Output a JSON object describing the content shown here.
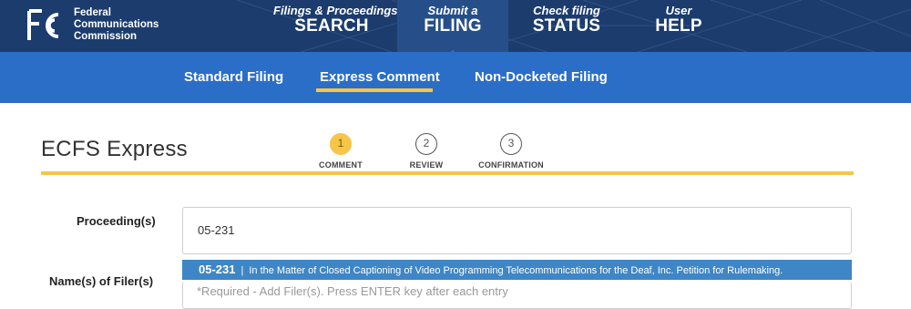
{
  "brand": {
    "logo_mark": "FCC",
    "name_lines": [
      "Federal",
      "Communications",
      "Commission"
    ]
  },
  "topnav": {
    "items": [
      {
        "sub": "Filings & Proceedings",
        "main": "SEARCH"
      },
      {
        "sub": "Submit a",
        "main": "FILING",
        "active": true
      },
      {
        "sub": "Check filing",
        "main": "STATUS"
      },
      {
        "sub": "User",
        "main": "HELP"
      }
    ]
  },
  "subnav": {
    "items": [
      "Standard Filing",
      "Express Comment",
      "Non-Docketed Filing"
    ],
    "active_index": 1
  },
  "page": {
    "title": "ECFS Express",
    "steps": [
      {
        "number": "1",
        "label": "COMMENT",
        "active": true
      },
      {
        "number": "2",
        "label": "REVIEW"
      },
      {
        "number": "3",
        "label": "CONFIRMATION"
      }
    ]
  },
  "form": {
    "proceeding_label": "Proceeding(s)",
    "proceeding_value": "05-231",
    "filers_label": "Name(s) of Filer(s)",
    "filers_placeholder": "*Required - Add Filer(s). Press ENTER key after each entry"
  },
  "autocomplete": {
    "code": "05-231",
    "separator": "|",
    "description": "In the Matter of Closed Captioning of Video Programming Telecommunications for the Deaf, Inc. Petition for Rulemaking."
  },
  "colors": {
    "topnav_bg": "#1b3c6d",
    "subnav_bg": "#2b6ec8",
    "accent_yellow": "#f7c548",
    "suggestion_bg": "#3f86c6"
  }
}
